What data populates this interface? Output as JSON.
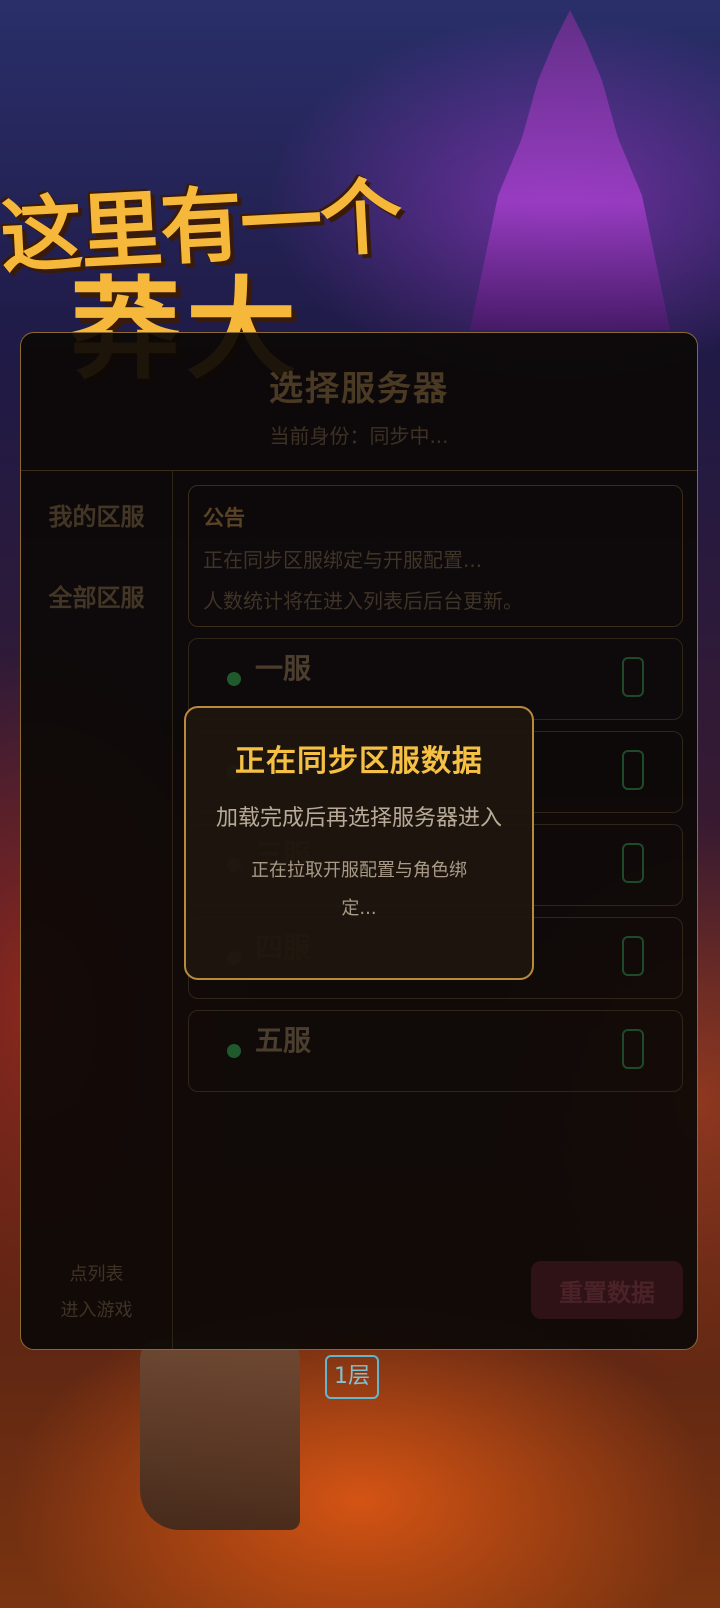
{
  "panel": {
    "title": "选择服务器",
    "subtitle": "当前身份：同步中..."
  },
  "sidebar": {
    "items": [
      {
        "label": "我的区服"
      },
      {
        "label": "全部区服"
      }
    ],
    "footer_line1": "点列表",
    "footer_line2": "进入游戏"
  },
  "notice": {
    "title": "公告",
    "line1": "正在同步区服绑定与开服配置...",
    "line2": "人数统计将在进入列表后后台更新。"
  },
  "servers": [
    {
      "name": "一服",
      "status_color": "#1f5a2c"
    },
    {
      "name": "二服",
      "status_color": "#1f5a2c"
    },
    {
      "name": "三服",
      "status_color": "#1f5a2c"
    },
    {
      "name": "四服",
      "status_color": "#1f5a2c"
    },
    {
      "name": "五服",
      "status_color": "#1f5a2c"
    }
  ],
  "reset_button": {
    "label": "重置数据"
  },
  "loading_dialog": {
    "title": "正在同步区服数据",
    "message": "加载完成后再选择服务器进入",
    "detail": "正在拉取开服配置与角色绑定..."
  },
  "background": {
    "logo_line1": "这里有一个",
    "logo_line2": "莽大",
    "floor_sign": "1层"
  },
  "colors": {
    "accent": "#f5c043",
    "dialog_border": "#b98a3c",
    "online_dot": "#1f5a2c"
  }
}
